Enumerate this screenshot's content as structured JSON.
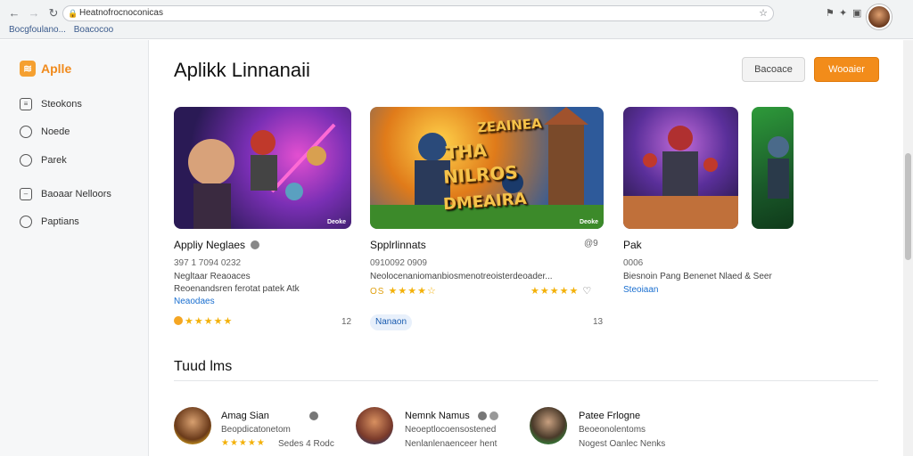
{
  "browser": {
    "url": "Heatnofrocnoconicas",
    "bookmarks": [
      "Bocgfoulano...",
      "Boacocoo"
    ]
  },
  "sidebar": {
    "brand": "Aplle",
    "items": [
      {
        "label": "Steokons",
        "icon": "book-icon"
      },
      {
        "label": "Noede",
        "icon": "circle-icon"
      },
      {
        "label": "Parek",
        "icon": "search-icon"
      },
      {
        "label": "Baoaar Nelloors",
        "icon": "folder-icon"
      },
      {
        "label": "Paptians",
        "icon": "globe-icon"
      }
    ]
  },
  "header": {
    "title": "Aplikk Linnanaii",
    "secondary_button": "Bacoace",
    "primary_button": "Wooaier"
  },
  "cards": [
    {
      "title": "Appliy Neglaes",
      "meta": "397 1 7094 0232",
      "line1": "Negltaar Reaoaces",
      "line2": "Reoenandsren ferotat patek Atk",
      "link": "Neaodaes",
      "count": "12",
      "badge": "Deoke"
    },
    {
      "title": "Spplrlinnats",
      "meta": "0910092 0909",
      "meta_right": "@9",
      "line1": "Neolocenaniomanbiosmenotreoisterdeoader...",
      "rating_left": "OS",
      "pill": "Nanaon",
      "count": "13",
      "overlay1": "ZEAINEA",
      "overlay2": "THA",
      "overlay3": "NILROS",
      "overlay4": "DMEAIRA",
      "badge": "Deoke"
    },
    {
      "title": "Pak",
      "meta": "0006",
      "line1": "Biesnoin Pang Benenet Nlaed & Seer",
      "link": "Steoiaan"
    }
  ],
  "section_title": "Tuud lms",
  "reviews": [
    {
      "name": "Amag Sian",
      "line1": "Beopdicatonetom",
      "line2": "Sedes 4 Rodc"
    },
    {
      "name": "Nemnk Namus",
      "line1": "Neoeptlocoensostened",
      "line2": "Nenlanlenaenceer hent"
    },
    {
      "name": "Patee Frlogne",
      "line1": "Beoeonolentoms",
      "line2": "Nogest Oanlec Nenks"
    }
  ],
  "colors": {
    "accent": "#f28c1a",
    "link": "#1a6fd0",
    "star": "#f3b10a"
  }
}
